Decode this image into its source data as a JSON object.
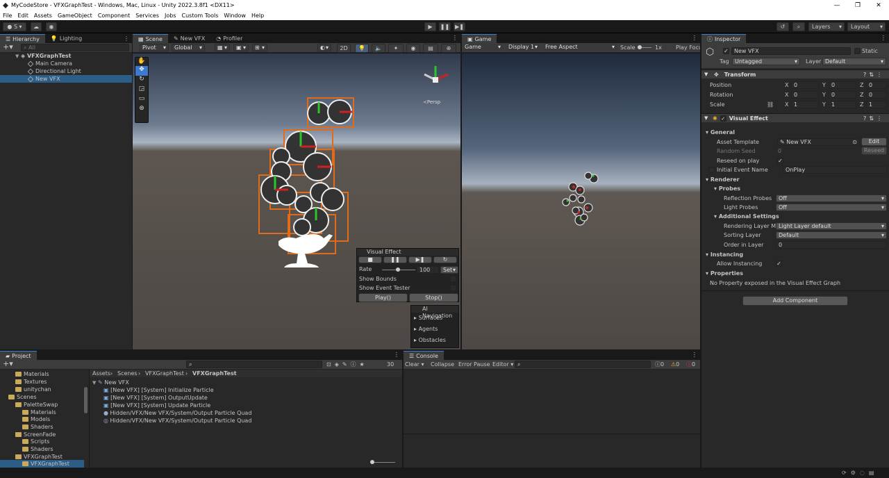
{
  "window": {
    "title": "MyCodeStore - VFXGraphTest - Windows, Mac, Linux - Unity 2022.3.8f1 <DX11>",
    "min": "—",
    "max": "❐",
    "close": "✕"
  },
  "menu": [
    "File",
    "Edit",
    "Assets",
    "GameObject",
    "Component",
    "Services",
    "Jobs",
    "Custom Tools",
    "Window",
    "Help"
  ],
  "toolbar": {
    "account": "S",
    "layers": "Layers",
    "layout": "Layout"
  },
  "hierarchy": {
    "tabs": [
      "Hierarchy",
      "Lighting"
    ],
    "search_placeholder": "All",
    "scene": "VFXGraphTest",
    "items": [
      "Main Camera",
      "Directional Light",
      "New VFX"
    ]
  },
  "scene": {
    "tabs": [
      "Scene",
      "New VFX",
      "Profiler"
    ],
    "pivot": "Pivot",
    "global": "Global",
    "mode2d": "2D",
    "persp": "≺Persp"
  },
  "vfx_overlay": {
    "title": "Visual Effect",
    "rate_label": "Rate",
    "rate_value": "100",
    "set": "Set",
    "show_bounds": "Show Bounds",
    "show_event_tester": "Show Event Tester",
    "play": "Play()",
    "stop": "Stop()"
  },
  "ai_nav": {
    "title": "AI Navigation",
    "items": [
      "Surfaces",
      "Agents",
      "Obstacles"
    ]
  },
  "game": {
    "tab": "Game",
    "mode": "Game",
    "display": "Display 1",
    "aspect": "Free Aspect",
    "scale_label": "Scale",
    "scale_value": "1x",
    "play_focus": "Play Focu"
  },
  "inspector": {
    "tab": "Inspector",
    "name": "New VFX",
    "static": "Static",
    "tag_label": "Tag",
    "tag": "Untagged",
    "layer_label": "Layer",
    "layer": "Default",
    "transform": {
      "title": "Transform",
      "rows": [
        {
          "label": "Position",
          "x": "0",
          "y": "0",
          "z": "0"
        },
        {
          "label": "Rotation",
          "x": "0",
          "y": "0",
          "z": "0"
        },
        {
          "label": "Scale",
          "x": "1",
          "y": "1",
          "z": "1"
        }
      ]
    },
    "vfx": {
      "title": "Visual Effect",
      "general": "General",
      "asset_template_label": "Asset Template",
      "asset_template": "New VFX",
      "edit": "Edit",
      "random_seed_label": "Random Seed",
      "random_seed": "0",
      "reseed": "Reseed",
      "reseed_on_play_label": "Reseed on play",
      "initial_event_label": "Initial Event Name",
      "initial_event": "OnPlay",
      "renderer": "Renderer",
      "probes": "Probes",
      "reflection_label": "Reflection Probes",
      "reflection": "Off",
      "light_probes_label": "Light Probes",
      "light_probes": "Off",
      "additional": "Additional Settings",
      "rendering_layer_label": "Rendering Layer Ma",
      "rendering_layer": "Light Layer default",
      "sorting_layer_label": "Sorting Layer",
      "sorting_layer": "Default",
      "order_label": "Order in Layer",
      "order": "0",
      "instancing": "Instancing",
      "allow_instancing": "Allow Instancing",
      "properties": "Properties",
      "no_props": "No Property exposed in the Visual Effect Graph"
    },
    "add_component": "Add Component"
  },
  "project": {
    "tab": "Project",
    "tree": [
      {
        "label": "Materials",
        "depth": 2
      },
      {
        "label": "Textures",
        "depth": 2
      },
      {
        "label": "unitychan",
        "depth": 2
      },
      {
        "label": "Scenes",
        "depth": 1
      },
      {
        "label": "PaletteSwap",
        "depth": 2
      },
      {
        "label": "Materials",
        "depth": 3
      },
      {
        "label": "Models",
        "depth": 3
      },
      {
        "label": "Shaders",
        "depth": 3
      },
      {
        "label": "ScreenFade",
        "depth": 2
      },
      {
        "label": "Scripts",
        "depth": 3
      },
      {
        "label": "Shaders",
        "depth": 3
      },
      {
        "label": "VFXGraphTest",
        "depth": 2
      },
      {
        "label": "VFXGraphTest",
        "depth": 3
      }
    ],
    "breadcrumb": [
      "Assets",
      "Scenes",
      "VFXGraphTest",
      "VFXGraphTest"
    ],
    "hidden_count": "30",
    "asset_root": "New VFX",
    "assets": [
      "[New VFX] [System] Initialize Particle",
      "[New VFX] [System] OutputUpdate",
      "[New VFX] [System] Update Particle",
      "Hidden/VFX/New VFX/System/Output Particle Quad",
      "Hidden/VFX/New VFX/System/Output Particle Quad"
    ]
  },
  "console": {
    "tab": "Console",
    "clear": "Clear",
    "collapse": "Collapse",
    "error_pause": "Error Pause",
    "editor": "Editor",
    "info": "0",
    "warn": "0",
    "err": "0"
  }
}
